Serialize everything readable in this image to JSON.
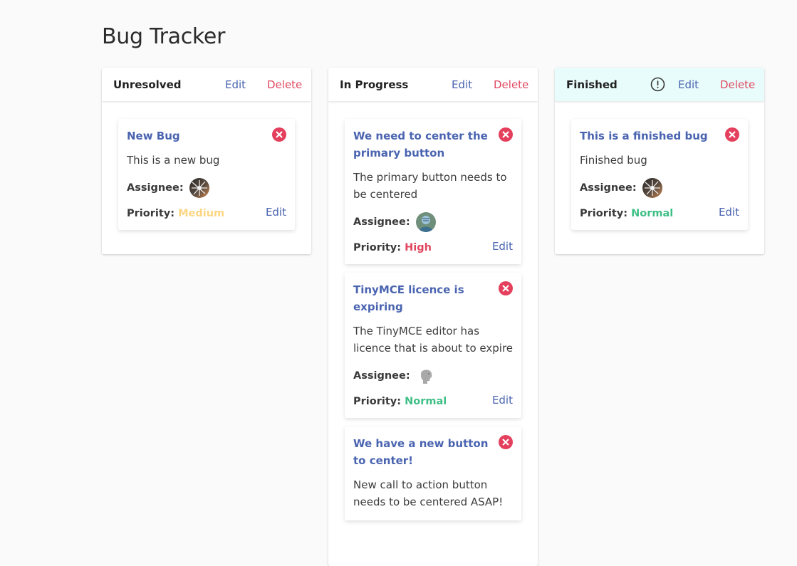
{
  "app": {
    "title": "Bug Tracker"
  },
  "columns": [
    {
      "title": "Unresolved",
      "edit_label": "Edit",
      "delete_label": "Delete",
      "cards": [
        {
          "title": "New Bug",
          "description": "This is a new bug",
          "assignee_label": "Assignee:",
          "priority_label": "Priority:",
          "priority": "Medium",
          "priority_color": "#fcd682",
          "edit_label": "Edit"
        }
      ]
    },
    {
      "title": "In Progress",
      "edit_label": "Edit",
      "delete_label": "Delete",
      "cards": [
        {
          "title": "We need to center the primary button",
          "description": "The primary button needs to be centered",
          "assignee_label": "Assignee:",
          "priority_label": "Priority:",
          "priority": "High",
          "priority_color": "#e0475f",
          "edit_label": "Edit"
        },
        {
          "title": "TinyMCE licence is expiring",
          "description": "The TinyMCE editor has licence that is about to expire",
          "assignee_label": "Assignee:",
          "priority_label": "Priority:",
          "priority": "Normal",
          "priority_color": "#3fbf86",
          "edit_label": "Edit"
        },
        {
          "title": "We have a new button to center!",
          "description": "New call to action button needs to be centered ASAP!"
        }
      ]
    },
    {
      "title": "Finished",
      "edit_label": "Edit",
      "delete_label": "Delete",
      "header_bg": "#e8fdfb",
      "cards": [
        {
          "title": "This is a finished bug",
          "description": "Finished bug",
          "assignee_label": "Assignee:",
          "priority_label": "Priority:",
          "priority": "Normal",
          "priority_color": "#3fbf86",
          "edit_label": "Edit"
        }
      ]
    }
  ],
  "colors": {
    "link": "#4a64b0",
    "danger": "#e0475f",
    "background": "#fafafa"
  }
}
